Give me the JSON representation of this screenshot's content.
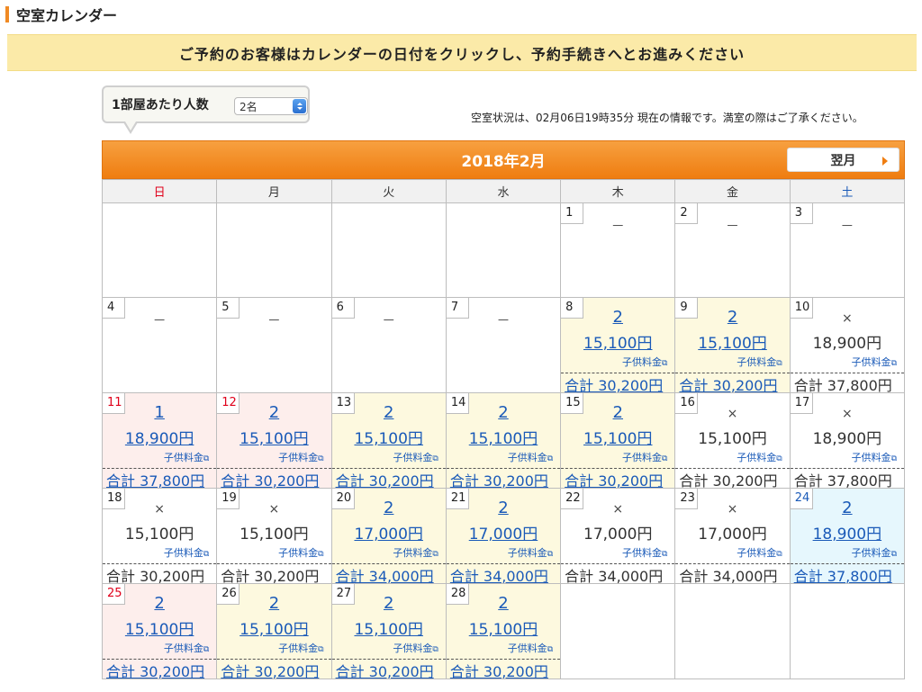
{
  "page": {
    "section_title": "空室カレンダー",
    "notice": "ご予約のお客様はカレンダーの日付をクリックし、予約手続きへとお進みください"
  },
  "people": {
    "label": "1部屋あたり人数",
    "selected": "2名"
  },
  "status_text": "空室状況は、02月06日19時35分 現在の情報です。満室の際はご了承ください。",
  "calendar": {
    "month_title": "2018年2月",
    "next_label": "翌月",
    "weekdays": [
      "日",
      "月",
      "火",
      "水",
      "木",
      "金",
      "土"
    ],
    "child_label": "子供料金",
    "weeks": [
      [
        {
          "day": ""
        },
        {
          "day": ""
        },
        {
          "day": ""
        },
        {
          "day": ""
        },
        {
          "day": "1",
          "avail": "－"
        },
        {
          "day": "2",
          "avail": "－"
        },
        {
          "day": "3",
          "avail": "－"
        }
      ],
      [
        {
          "day": "4",
          "avail": "－"
        },
        {
          "day": "5",
          "avail": "－"
        },
        {
          "day": "6",
          "avail": "－"
        },
        {
          "day": "7",
          "avail": "－"
        },
        {
          "day": "8",
          "avail": "2",
          "price": "15,100円",
          "total": "合計 30,200円"
        },
        {
          "day": "9",
          "avail": "2",
          "price": "15,100円",
          "total": "合計 30,200円"
        },
        {
          "day": "10",
          "avail": "×",
          "price": "18,900円",
          "total": "合計 37,800円"
        }
      ],
      [
        {
          "day": "11",
          "avail": "1",
          "price": "18,900円",
          "total": "合計 37,800円"
        },
        {
          "day": "12",
          "avail": "2",
          "price": "15,100円",
          "total": "合計 30,200円"
        },
        {
          "day": "13",
          "avail": "2",
          "price": "15,100円",
          "total": "合計 30,200円"
        },
        {
          "day": "14",
          "avail": "2",
          "price": "15,100円",
          "total": "合計 30,200円"
        },
        {
          "day": "15",
          "avail": "2",
          "price": "15,100円",
          "total": "合計 30,200円"
        },
        {
          "day": "16",
          "avail": "×",
          "price": "15,100円",
          "total": "合計 30,200円"
        },
        {
          "day": "17",
          "avail": "×",
          "price": "18,900円",
          "total": "合計 37,800円"
        }
      ],
      [
        {
          "day": "18",
          "avail": "×",
          "price": "15,100円",
          "total": "合計 30,200円"
        },
        {
          "day": "19",
          "avail": "×",
          "price": "15,100円",
          "total": "合計 30,200円"
        },
        {
          "day": "20",
          "avail": "2",
          "price": "17,000円",
          "total": "合計 34,000円"
        },
        {
          "day": "21",
          "avail": "2",
          "price": "17,000円",
          "total": "合計 34,000円"
        },
        {
          "day": "22",
          "avail": "×",
          "price": "17,000円",
          "total": "合計 34,000円"
        },
        {
          "day": "23",
          "avail": "×",
          "price": "17,000円",
          "total": "合計 34,000円"
        },
        {
          "day": "24",
          "avail": "2",
          "price": "18,900円",
          "total": "合計 37,800円"
        }
      ],
      [
        {
          "day": "25",
          "avail": "2",
          "price": "15,100円",
          "total": "合計 30,200円"
        },
        {
          "day": "26",
          "avail": "2",
          "price": "15,100円",
          "total": "合計 30,200円"
        },
        {
          "day": "27",
          "avail": "2",
          "price": "15,100円",
          "total": "合計 30,200円"
        },
        {
          "day": "28",
          "avail": "2",
          "price": "15,100円",
          "total": "合計 30,200円"
        },
        {
          "day": ""
        },
        {
          "day": ""
        },
        {
          "day": ""
        }
      ]
    ]
  },
  "colors": {
    "accent_orange": "#ef7d10",
    "notice_bg": "#fbeaa8",
    "available_bg": "#fdf9df",
    "holiday_bg": "#fdeeec",
    "saturday_bg": "#e6f7fd",
    "link_blue": "#1a5ab8",
    "sunday_red": "#e0001a"
  }
}
